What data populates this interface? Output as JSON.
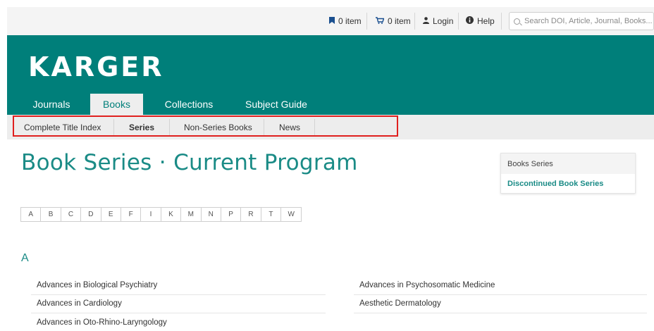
{
  "topbar": {
    "bookmarks": "0 item",
    "cart": "0 item",
    "login": "Login",
    "help": "Help",
    "search_placeholder": "Search DOI, Article, Journal, Books..."
  },
  "brand": {
    "logo": "KARGER",
    "color": "#007f7a"
  },
  "main_nav": [
    {
      "label": "Journals"
    },
    {
      "label": "Books",
      "active": true
    },
    {
      "label": "Collections"
    },
    {
      "label": "Subject Guide"
    }
  ],
  "sub_nav": [
    {
      "label": "Complete Title Index"
    },
    {
      "label": "Series",
      "active": true
    },
    {
      "label": "Non-Series Books"
    },
    {
      "label": "News"
    }
  ],
  "page_title": "Book Series · Current Program",
  "sidebar": {
    "header": "Books Series",
    "link": "Discontinued Book Series"
  },
  "alphabet": [
    "A",
    "B",
    "C",
    "D",
    "E",
    "F",
    "I",
    "K",
    "M",
    "N",
    "P",
    "R",
    "T",
    "W"
  ],
  "section_letter": "A",
  "series_left": [
    "Advances in Biological Psychiatry",
    "Advances in Cardiology",
    "Advances in Oto-Rhino-Laryngology"
  ],
  "series_right": [
    "Advances in Psychosomatic Medicine",
    "Aesthetic Dermatology"
  ],
  "icons": {
    "bookmark": "bookmark-icon",
    "cart": "cart-icon",
    "user": "user-icon",
    "help": "info-icon",
    "search": "search-icon"
  },
  "colors": {
    "accent": "#1a8b86",
    "highlight_box": "#e0201f"
  }
}
